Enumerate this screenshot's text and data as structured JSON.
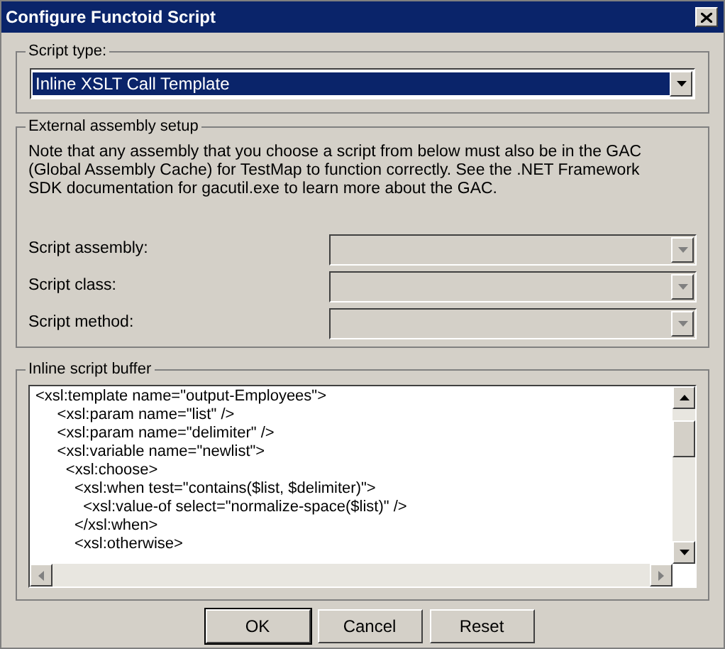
{
  "window": {
    "title": "Configure Functoid Script"
  },
  "script_type": {
    "legend": "Script type:",
    "value": "Inline XSLT Call Template",
    "focused": true
  },
  "external_assembly": {
    "legend": "External assembly setup",
    "note": "Note that any assembly that you choose a script from below must also be in the GAC (Global Assembly Cache) for TestMap to function correctly.  See the .NET Framework SDK documentation for gacutil.exe to learn more about the GAC.",
    "fields": [
      {
        "label": "Script assembly:",
        "disabled": true
      },
      {
        "label": "Script class:",
        "disabled": true
      },
      {
        "label": "Script method:",
        "disabled": true
      }
    ]
  },
  "inline_script": {
    "legend": "Inline script buffer",
    "lines": [
      "<xsl:template name=\"output-Employees\">",
      "     <xsl:param name=\"list\" />",
      "     <xsl:param name=\"delimiter\" />",
      "     <xsl:variable name=\"newlist\">",
      "       <xsl:choose>",
      "         <xsl:when test=\"contains($list, $delimiter)\">",
      "           <xsl:value-of select=\"normalize-space($list)\" />",
      "         </xsl:when>",
      "         <xsl:otherwise>"
    ]
  },
  "buttons": [
    {
      "label": "OK",
      "default": true
    },
    {
      "label": "Cancel",
      "default": false
    },
    {
      "label": "Reset",
      "default": false
    }
  ]
}
